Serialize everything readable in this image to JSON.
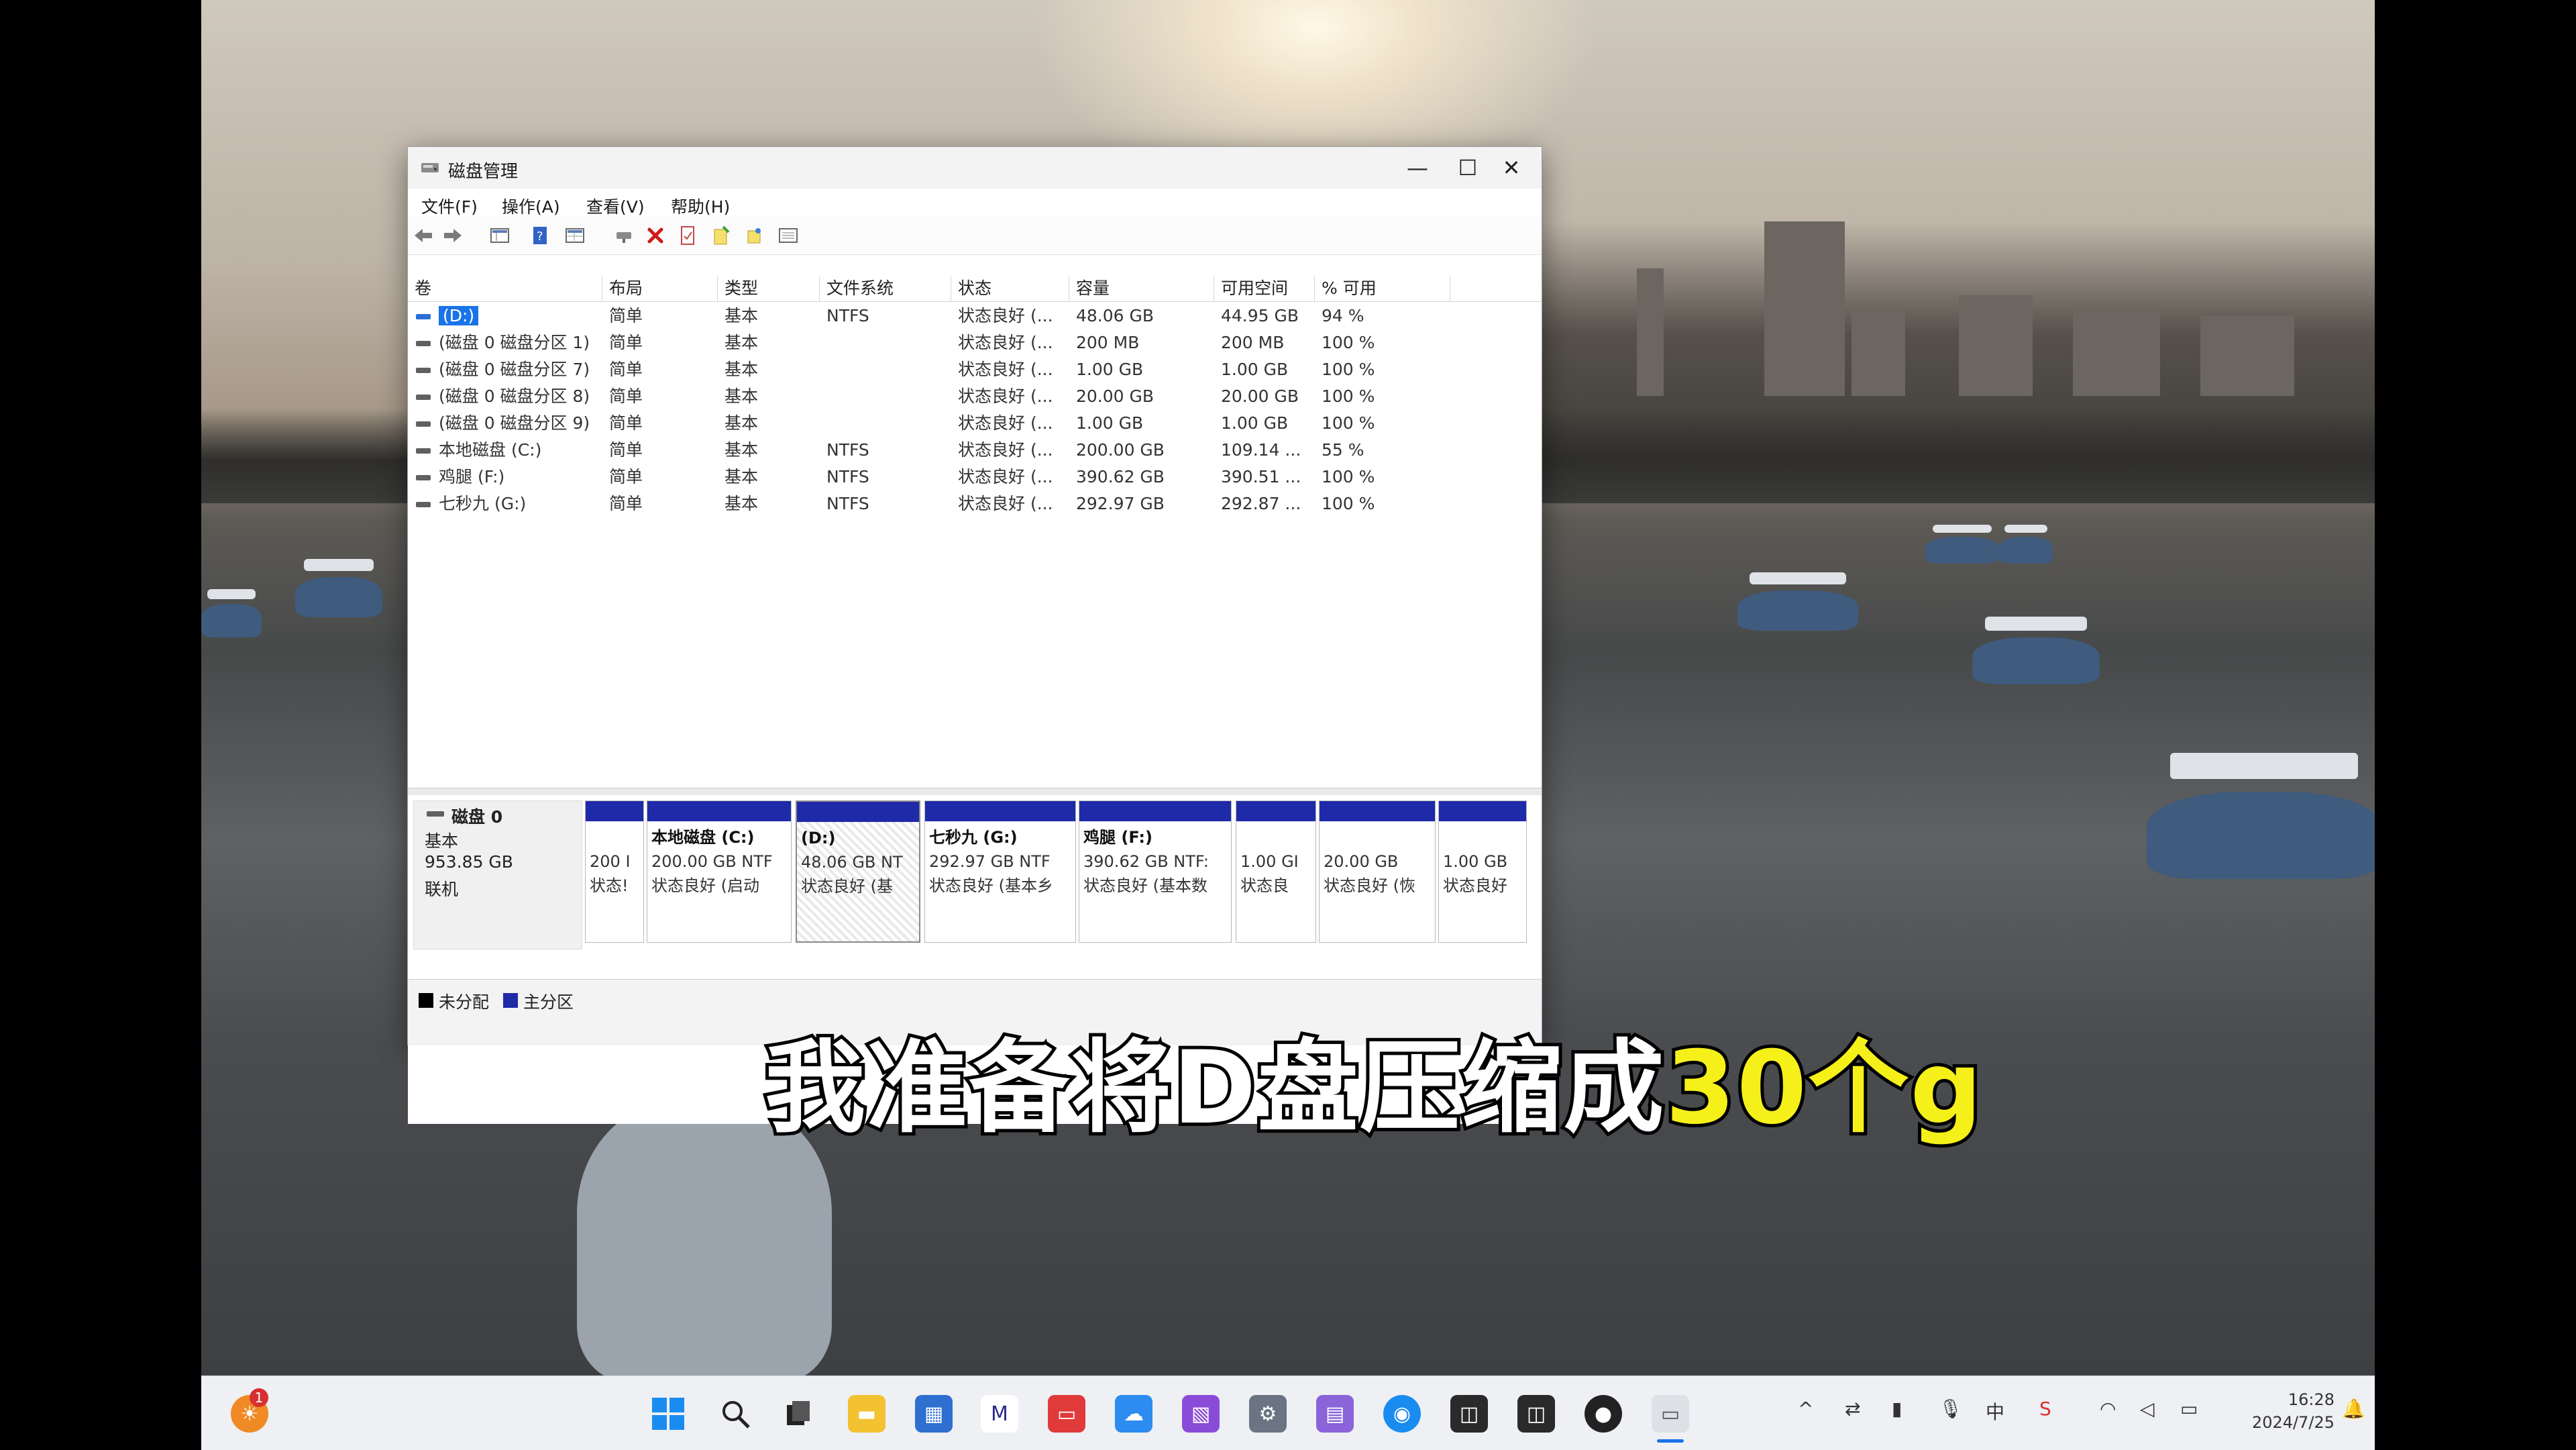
{
  "window": {
    "title": "磁盘管理",
    "menu": [
      "文件(F)",
      "操作(A)",
      "查看(V)",
      "帮助(H)"
    ]
  },
  "volumes": {
    "columns": [
      "卷",
      "布局",
      "类型",
      "文件系统",
      "状态",
      "容量",
      "可用空间",
      "% 可用"
    ],
    "rows": [
      {
        "name": "(D:)",
        "layout": "简单",
        "type": "基本",
        "fs": "NTFS",
        "status": "状态良好 (...",
        "capacity": "48.06 GB",
        "free": "44.95 GB",
        "pct": "94 %"
      },
      {
        "name": "(磁盘 0 磁盘分区 1)",
        "layout": "简单",
        "type": "基本",
        "fs": "",
        "status": "状态良好 (...",
        "capacity": "200 MB",
        "free": "200 MB",
        "pct": "100 %"
      },
      {
        "name": "(磁盘 0 磁盘分区 7)",
        "layout": "简单",
        "type": "基本",
        "fs": "",
        "status": "状态良好 (...",
        "capacity": "1.00 GB",
        "free": "1.00 GB",
        "pct": "100 %"
      },
      {
        "name": "(磁盘 0 磁盘分区 8)",
        "layout": "简单",
        "type": "基本",
        "fs": "",
        "status": "状态良好 (...",
        "capacity": "20.00 GB",
        "free": "20.00 GB",
        "pct": "100 %"
      },
      {
        "name": "(磁盘 0 磁盘分区 9)",
        "layout": "简单",
        "type": "基本",
        "fs": "",
        "status": "状态良好 (...",
        "capacity": "1.00 GB",
        "free": "1.00 GB",
        "pct": "100 %"
      },
      {
        "name": "本地磁盘 (C:)",
        "layout": "简单",
        "type": "基本",
        "fs": "NTFS",
        "status": "状态良好 (...",
        "capacity": "200.00 GB",
        "free": "109.14 ...",
        "pct": "55 %"
      },
      {
        "name": "鸡腿 (F:)",
        "layout": "简单",
        "type": "基本",
        "fs": "NTFS",
        "status": "状态良好 (...",
        "capacity": "390.62 GB",
        "free": "390.51 ...",
        "pct": "100 %"
      },
      {
        "name": "七秒九 (G:)",
        "layout": "简单",
        "type": "基本",
        "fs": "NTFS",
        "status": "状态良好 (...",
        "capacity": "292.97 GB",
        "free": "292.87 ...",
        "pct": "100 %"
      }
    ]
  },
  "disk": {
    "name": "磁盘 0",
    "type": "基本",
    "size": "953.85 GB",
    "state": "联机",
    "partitions": [
      {
        "title": "",
        "l1": "200 I",
        "l2": "状态!"
      },
      {
        "title": "本地磁盘 (C:)",
        "l1": "200.00 GB NTF",
        "l2": "状态良好 (启动"
      },
      {
        "title": "(D:)",
        "l1": "48.06 GB NT",
        "l2": "状态良好 (基"
      },
      {
        "title": "七秒九 (G:)",
        "l1": "292.97 GB NTF",
        "l2": "状态良好 (基本乡"
      },
      {
        "title": "鸡腿 (F:)",
        "l1": "390.62 GB NTF:",
        "l2": "状态良好 (基本数"
      },
      {
        "title": "",
        "l1": "1.00 GI",
        "l2": "状态良"
      },
      {
        "title": "",
        "l1": "20.00 GB",
        "l2": "状态良好 (恢"
      },
      {
        "title": "",
        "l1": "1.00 GB",
        "l2": "状态良好"
      }
    ]
  },
  "legend": {
    "unallocated": "未分配",
    "primary": "主分区"
  },
  "caption": {
    "main": "我准备将D盘压缩成",
    "highlight": "30个g"
  },
  "taskbar": {
    "notification_badge": "1",
    "time": "16:28",
    "date": "2024/7/25",
    "colors": {
      "accent": "#1f2aa8",
      "caption_highlight": "#f6f01a"
    }
  }
}
